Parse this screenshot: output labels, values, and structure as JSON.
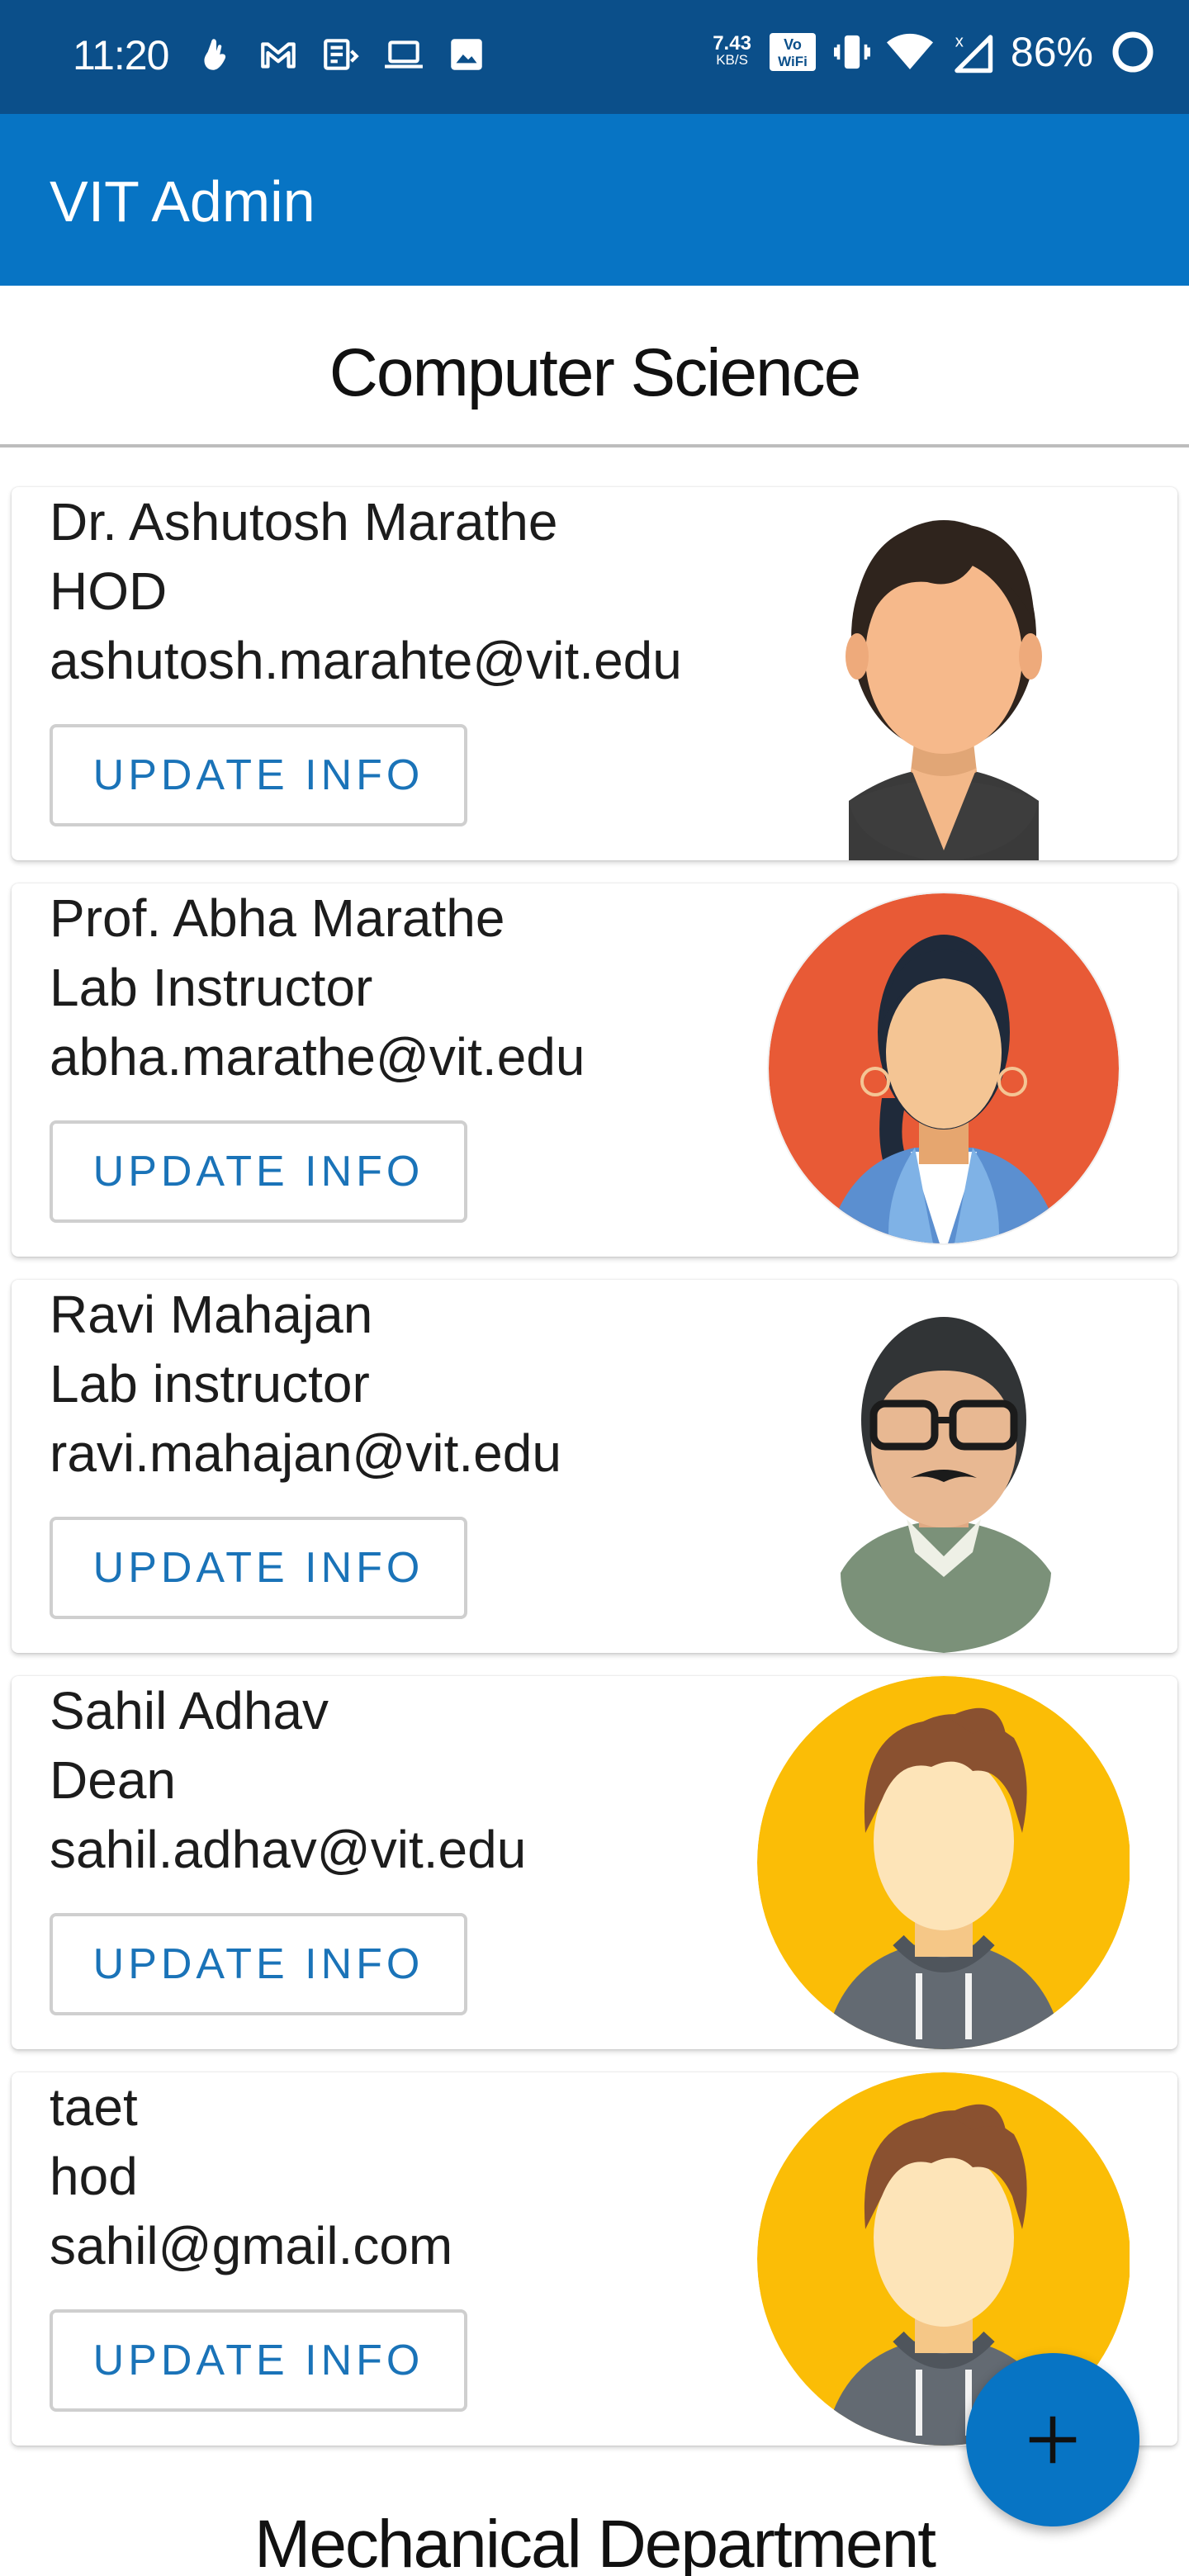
{
  "status_bar": {
    "time": "11:20",
    "net_speed": "7.43",
    "net_unit": "KB/S",
    "wifi_call": "Vo WiFi",
    "battery": "86%"
  },
  "app_bar": {
    "title": "VIT Admin"
  },
  "sections": [
    {
      "heading": "Computer Science",
      "staff": [
        {
          "name": "Dr. Ashutosh Marathe",
          "role": "HOD",
          "email": "ashutosh.marahte@vit.edu",
          "avatar": "woman-dark-hair-avatar",
          "button": "UPDATE INFO"
        },
        {
          "name": "Prof. Abha Marathe",
          "role": "Lab Instructor",
          "email": "abha.marathe@vit.edu",
          "avatar": "woman-earrings-orange-avatar",
          "button": "UPDATE INFO"
        },
        {
          "name": "Ravi Mahajan",
          "role": "Lab instructor",
          "email": "ravi.mahajan@vit.edu",
          "avatar": "man-glasses-mustache-avatar",
          "button": "UPDATE INFO"
        },
        {
          "name": "Sahil Adhav",
          "role": "Dean",
          "email": "sahil.adhav@vit.edu",
          "avatar": "man-hoodie-yellow-avatar",
          "button": "UPDATE INFO"
        },
        {
          "name": "taet",
          "role": "hod",
          "email": "sahil@gmail.com",
          "avatar": "man-hoodie-yellow-avatar",
          "button": "UPDATE INFO"
        }
      ]
    },
    {
      "heading": "Mechanical Department"
    }
  ],
  "fab": {
    "icon": "plus-icon"
  },
  "colors": {
    "status_bar": "#0b4f8a",
    "app_bar": "#0774c4",
    "button_text": "#1a73b8",
    "fab": "#0774c4"
  }
}
